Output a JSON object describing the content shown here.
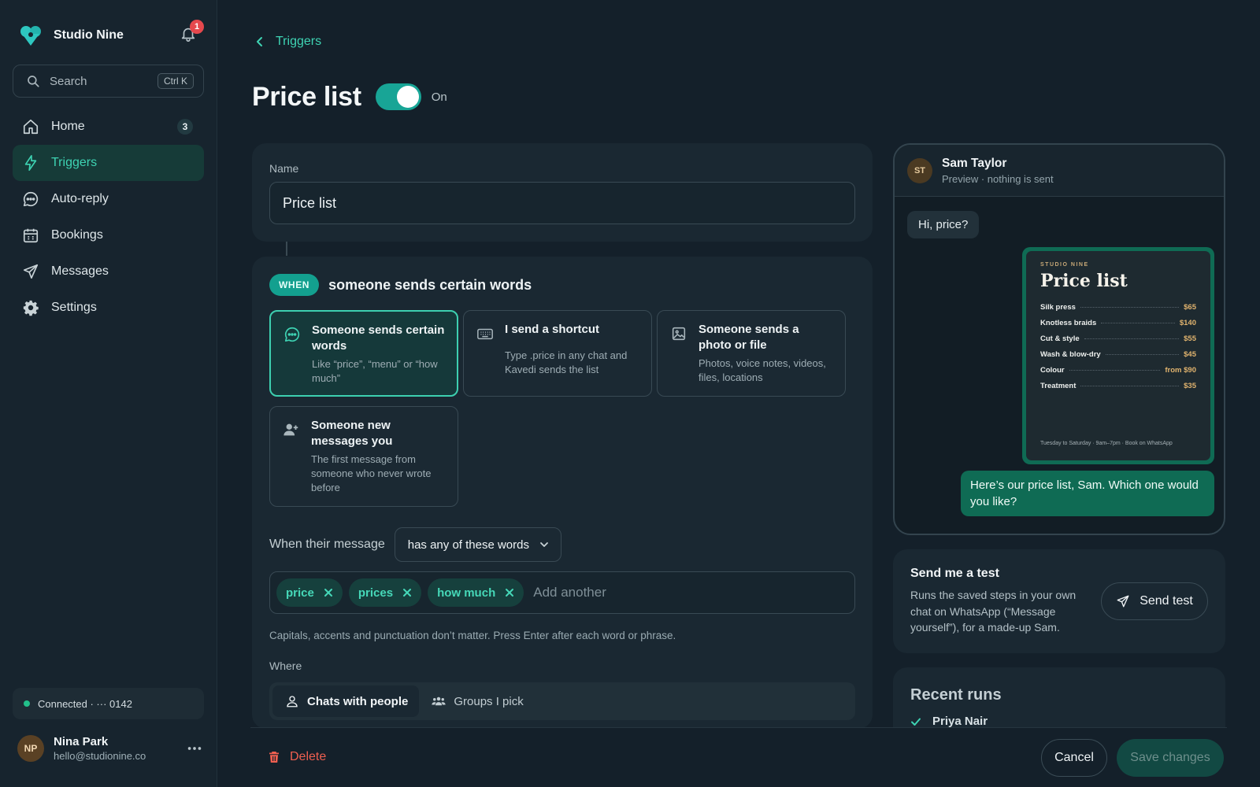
{
  "colors": {
    "accent": "#3ed3b3",
    "toggle_on": "#18a596",
    "danger": "#ef5f50",
    "notification": "#e5484d",
    "connected": "#22c08a",
    "outgoing_bubble": "#0f6b54"
  },
  "sidebar": {
    "brand_name": "Studio Nine",
    "notification_count": "1",
    "search": {
      "placeholder": "Search",
      "shortcut": "Ctrl K"
    },
    "items": [
      {
        "label": "Home",
        "icon": "home-icon",
        "count": "3"
      },
      {
        "label": "Triggers",
        "icon": "bolt-icon",
        "active": true
      },
      {
        "label": "Auto-reply",
        "icon": "chat-icon"
      },
      {
        "label": "Bookings",
        "icon": "calendar-icon"
      },
      {
        "label": "Messages",
        "icon": "send-icon"
      },
      {
        "label": "Settings",
        "icon": "gear-icon"
      }
    ],
    "connection": "Connected · ··· 0142",
    "user": {
      "initials": "NP",
      "name": "Nina Park",
      "email": "hello@studionine.co"
    }
  },
  "header": {
    "breadcrumb": "Triggers",
    "title": "Price list",
    "toggle_label": "On",
    "toggle_on": true
  },
  "name_card": {
    "label": "Name",
    "value": "Price list"
  },
  "when_card": {
    "badge": "WHEN",
    "summary": "someone sends certain words",
    "options": [
      {
        "title": "Someone sends certain words",
        "desc": "Like “price”, “menu” or “how much”",
        "icon": "chat-icon",
        "selected": true
      },
      {
        "title": "I send a shortcut",
        "desc": "Type .price in any chat and Kavedi sends the list",
        "icon": "keyboard-icon",
        "selected": false
      },
      {
        "title": "Someone sends a photo or file",
        "desc": "Photos, voice notes, videos, files, locations",
        "icon": "image-icon",
        "selected": false
      },
      {
        "title": "Someone new messages you",
        "desc": "The first message from someone who never wrote before",
        "icon": "user-plus-icon",
        "selected": false
      }
    ],
    "match_label": "When their message",
    "match_value": "has any of these words",
    "tags": [
      "price",
      "prices",
      "how much"
    ],
    "tag_placeholder": "Add another",
    "hint": "Capitals, accents and punctuation don’t matter. Press Enter after each word or phrase.",
    "where_label": "Where",
    "where_options": [
      {
        "label": "Chats with people",
        "icon": "person-icon",
        "active": true
      },
      {
        "label": "Groups I pick",
        "icon": "group-icon",
        "active": false
      }
    ]
  },
  "preview": {
    "contact_initials": "ST",
    "contact_name": "Sam Taylor",
    "subtitle": "Preview · nothing is sent",
    "incoming": "Hi, price?",
    "menu_image": {
      "kicker": "STUDIO NINE",
      "title": "Price list",
      "rows": [
        {
          "item": "Silk press",
          "price": "$65"
        },
        {
          "item": "Knotless braids",
          "price": "$140"
        },
        {
          "item": "Cut & style",
          "price": "$55"
        },
        {
          "item": "Wash & blow-dry",
          "price": "$45"
        },
        {
          "item": "Colour",
          "price": "from $90"
        },
        {
          "item": "Treatment",
          "price": "$35"
        }
      ],
      "footer": "Tuesday to Saturday · 9am–7pm · Book on WhatsApp"
    },
    "outgoing": "Here’s our price list, Sam. Which one would you like?"
  },
  "test_card": {
    "title": "Send me a test",
    "desc": "Runs the saved steps in your own chat on WhatsApp (“Message yourself”), for a made-up Sam.",
    "button": "Send test"
  },
  "runs_card": {
    "title": "Recent runs",
    "runs": [
      {
        "name": "Priya Nair"
      }
    ]
  },
  "footer": {
    "delete": "Delete",
    "cancel": "Cancel",
    "save": "Save changes"
  }
}
